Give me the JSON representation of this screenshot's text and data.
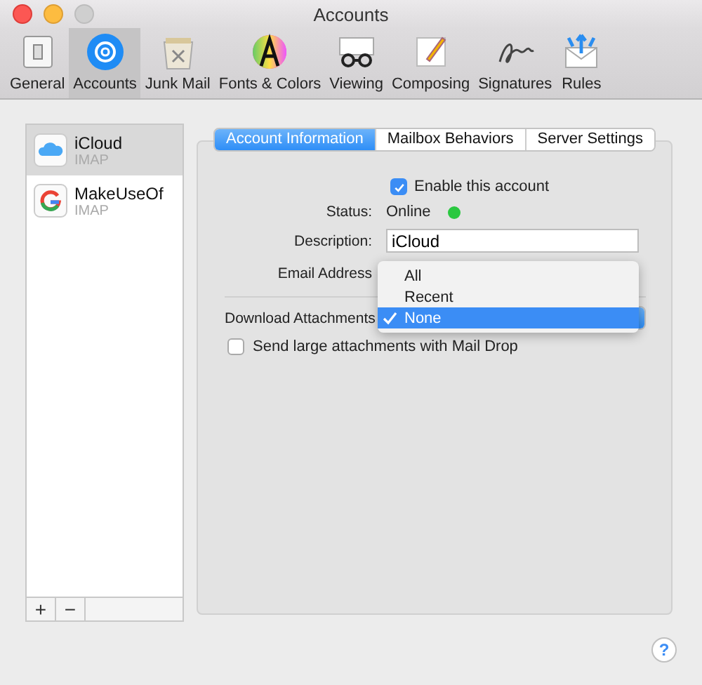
{
  "window": {
    "title": "Accounts"
  },
  "toolbar": {
    "items": [
      {
        "label": "General",
        "selected": false
      },
      {
        "label": "Accounts",
        "selected": true
      },
      {
        "label": "Junk Mail",
        "selected": false
      },
      {
        "label": "Fonts & Colors",
        "selected": false
      },
      {
        "label": "Viewing",
        "selected": false
      },
      {
        "label": "Composing",
        "selected": false
      },
      {
        "label": "Signatures",
        "selected": false
      },
      {
        "label": "Rules",
        "selected": false
      }
    ]
  },
  "accounts": [
    {
      "name": "iCloud",
      "type": "IMAP",
      "kind": "icloud",
      "selected": true
    },
    {
      "name": "MakeUseOf",
      "type": "IMAP",
      "kind": "google",
      "selected": false
    }
  ],
  "list_buttons": [
    "+",
    "−"
  ],
  "tabs": [
    {
      "label": "Account Information",
      "selected": true
    },
    {
      "label": "Mailbox Behaviors",
      "selected": false
    },
    {
      "label": "Server Settings",
      "selected": false
    }
  ],
  "form": {
    "enable": {
      "label": "Enable this account",
      "checked": true
    },
    "status": {
      "label": "Status:",
      "value": "Online",
      "color": "#2ac840"
    },
    "description": {
      "label": "Description:",
      "value": "iCloud"
    },
    "email_address": {
      "label": "Email Address"
    },
    "download_attachments": {
      "label": "Download Attachments"
    },
    "send_large": {
      "label": "Send large attachments with Mail Drop",
      "checked": false
    }
  },
  "popup_menu": {
    "items": [
      {
        "label": "All",
        "selected": false
      },
      {
        "label": "Recent",
        "selected": false
      },
      {
        "label": "None",
        "selected": true
      }
    ]
  },
  "help": "?"
}
